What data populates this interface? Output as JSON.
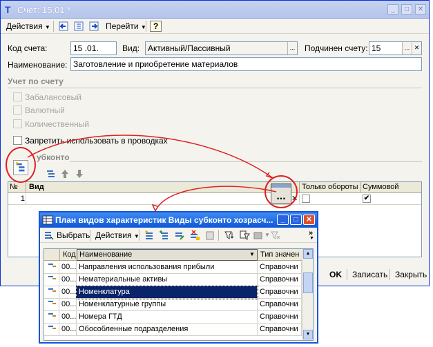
{
  "window": {
    "title": "Счет: 15.01 *",
    "controls": [
      "minimize",
      "maximize",
      "close"
    ]
  },
  "toolbar": {
    "actions_label": "Действия",
    "goto_label": "Перейти",
    "help_label": "?"
  },
  "form": {
    "account_code_label": "Код счета:",
    "account_code_value": "15 .01.",
    "type_label": "Вид:",
    "type_value": "Активный/Пассивный",
    "parent_label": "Подчинен счету:",
    "parent_value": "15",
    "name_label": "Наименование:",
    "name_value": "Заготовление и приобретение материалов",
    "section_title": "Учет по счету",
    "off_balance": "Забалансовый",
    "currency": "Валютный",
    "quantity": "Количественный",
    "forbid_postings": "Запретить использовать в проводках",
    "subkonto_title": "убконто"
  },
  "subkonto_table": {
    "columns": [
      "№",
      "Вид",
      "Только обороты",
      "Суммовой"
    ],
    "rows": [
      {
        "num": "1",
        "vid": "",
        "turnover_only": false,
        "summary": true
      }
    ]
  },
  "footer": {
    "ok_label": "OK",
    "save_label": "Записать",
    "close_label": "Закрыть"
  },
  "popup": {
    "title": "План видов характеристик Виды субконто хозрасч...",
    "select_label": "Выбрать",
    "actions_label": "Действия",
    "columns": [
      "Код",
      "Наименование",
      "Тип значен"
    ],
    "rows": [
      {
        "code": "00...",
        "name": "Направления использования прибыли",
        "type": "Справочни"
      },
      {
        "code": "00...",
        "name": "Нематериальные активы",
        "type": "Справочни"
      },
      {
        "code": "00...",
        "name": "Номенклатура",
        "type": "Справочни",
        "selected": true
      },
      {
        "code": "00...",
        "name": "Номенклатурные группы",
        "type": "Справочни"
      },
      {
        "code": "00...",
        "name": "Номера ГТД",
        "type": "Справочни"
      },
      {
        "code": "00...",
        "name": "Обособленные подразделения",
        "type": "Справочни"
      }
    ]
  },
  "colors": {
    "accent": "#0831d9",
    "selected_row": "#0a246a",
    "annotation": "#dd2222"
  }
}
